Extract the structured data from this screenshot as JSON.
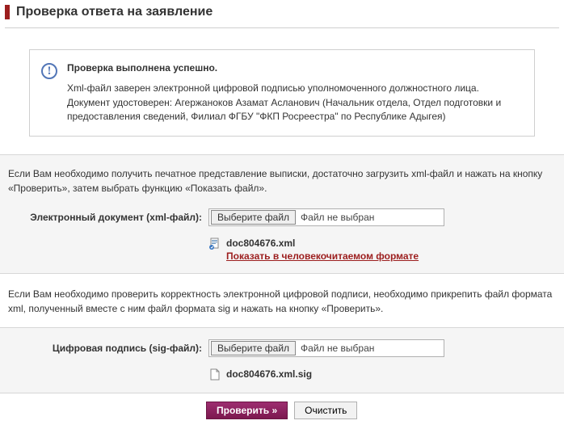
{
  "title": "Проверка ответа на заявление",
  "message": {
    "heading": "Проверка выполнена успешно.",
    "line1": "Xml-файл заверен электронной цифровой подписью уполномоченного должностного лица.",
    "line2": "Документ удостоверен: Агержаноков Азамат Асланович (Начальник отдела, Отдел подготовки и предоставления сведений, Филиал ФГБУ \"ФКП Росреестра\" по Республике Адыгея)"
  },
  "xmlSection": {
    "hint": "Если Вам необходимо получить печатное представление выписки, достаточно загрузить xml-файл и нажать на кнопку «Проверить», затем выбрать функцию «Показать файл».",
    "label": "Электронный документ (xml-файл):",
    "chooseBtn": "Выберите файл",
    "noFile": "Файл не выбран",
    "fileName": "doc804676.xml",
    "humanLink": "Показать в человекочитаемом формате"
  },
  "sigSection": {
    "hint": "Если Вам необходимо проверить корректность электронной цифровой подписи, необходимо прикрепить файл формата xml, полученный вместе с ним файл формата sig и нажать на кнопку «Проверить».",
    "label": "Цифровая подпись (sig-файл):",
    "chooseBtn": "Выберите файл",
    "noFile": "Файл не выбран",
    "fileName": "doc804676.xml.sig"
  },
  "buttons": {
    "check": "Проверить »",
    "clear": "Очистить"
  }
}
